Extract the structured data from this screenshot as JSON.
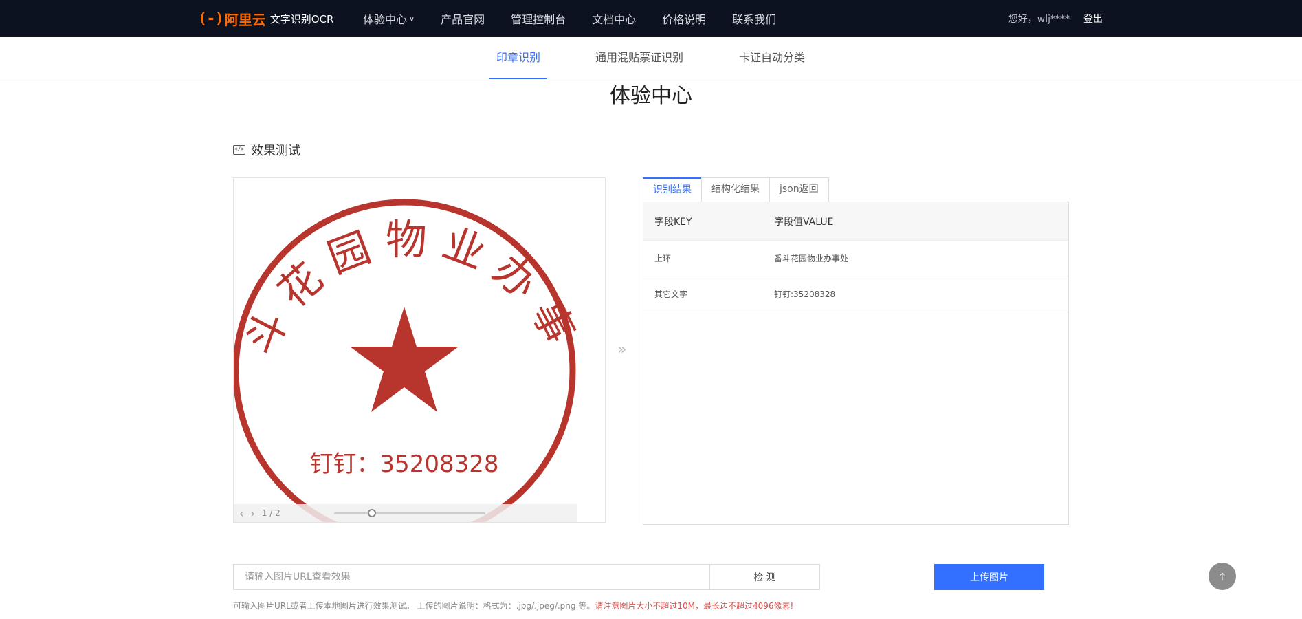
{
  "brand": {
    "mark": "(-)",
    "name": "阿里云",
    "product": "文字识别OCR"
  },
  "nav": {
    "items": [
      {
        "label": "体验中心",
        "has_dropdown": true
      },
      {
        "label": "产品官网"
      },
      {
        "label": "管理控制台"
      },
      {
        "label": "文档中心"
      },
      {
        "label": "价格说明"
      },
      {
        "label": "联系我们"
      }
    ],
    "greeting": "您好，wlj****",
    "logout": "登出",
    "dropdown_icon": "chevron-down-icon"
  },
  "subnav": {
    "tabs": [
      "印章识别",
      "通用混贴票证识别",
      "卡证自动分类"
    ],
    "active": 0
  },
  "page_title": "体验中心",
  "section_title": "效果测试",
  "stamp": {
    "outer_text": "番斗花园物业办事处",
    "bottom_text": "钉钉：35208328",
    "color": "#b8352e",
    "icon": "star-icon"
  },
  "pager": {
    "label": "1 / 2",
    "slider_fraction": 0.25
  },
  "result": {
    "tabs": [
      "识别结果",
      "结构化结果",
      "json返回"
    ],
    "active": 0,
    "header": {
      "key": "字段KEY",
      "value": "字段值VALUE"
    },
    "rows": [
      {
        "key": "上环",
        "value": "番斗花园物业办事处"
      },
      {
        "key": "其它文字",
        "value": "钉钉:35208328"
      }
    ]
  },
  "url_input": {
    "placeholder": "请输入图片URL查看效果",
    "value": ""
  },
  "detect_label": "检 测",
  "upload_label": "上传图片",
  "note": {
    "normal": "可输入图片URL或者上传本地图片进行效果测试。 上传的图片说明：格式为：.jpg/.jpeg/.png 等。",
    "warn": "请注意图片大小不超过10M，最长边不超过4096像素!"
  },
  "colors": {
    "primary": "#3370ff",
    "topbar": "#0d1221",
    "brand": "#ff6a00"
  }
}
